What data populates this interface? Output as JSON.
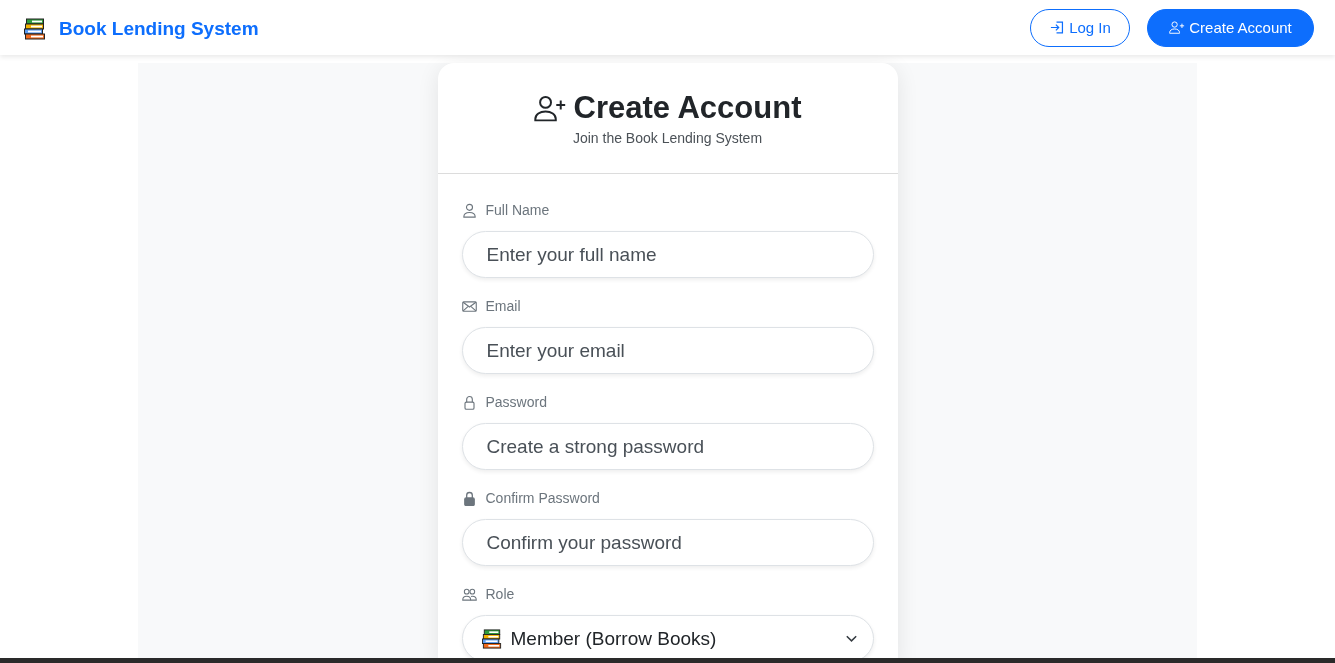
{
  "navbar": {
    "brand": "Book Lending System",
    "buttons": [
      {
        "label": "Log In",
        "kind": "login"
      },
      {
        "label": "Create Account",
        "kind": "signup"
      }
    ]
  },
  "card": {
    "title": "Create Account",
    "subtitle": "Join the Book Lending System"
  },
  "form": {
    "fields": [
      {
        "kind": "name",
        "label": "Full Name",
        "placeholder": "Enter your full name"
      },
      {
        "kind": "email",
        "label": "Email",
        "placeholder": "Enter your email"
      },
      {
        "kind": "password",
        "label": "Password",
        "placeholder": "Create a strong password"
      },
      {
        "kind": "confirm",
        "label": "Confirm Password",
        "placeholder": "Confirm your password"
      },
      {
        "kind": "select",
        "label": "Role",
        "value": "Member (Borrow Books)"
      }
    ]
  }
}
